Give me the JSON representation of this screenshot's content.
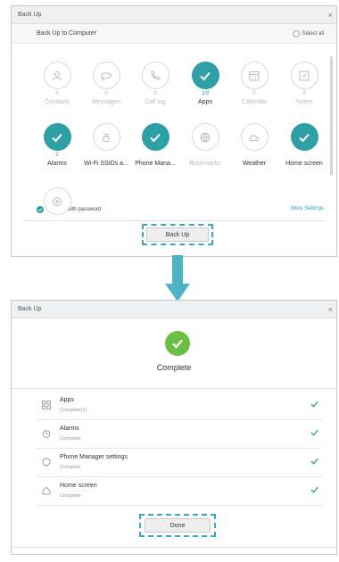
{
  "backup_window": {
    "title": "Back Up",
    "close": "×",
    "subheader": "Back Up to Computer",
    "select_all": "Select all",
    "items": [
      {
        "label": "Contacts",
        "count": "0",
        "selected": false,
        "icon": "contacts-icon"
      },
      {
        "label": "Messages",
        "count": "0",
        "selected": false,
        "icon": "messages-icon"
      },
      {
        "label": "Call log",
        "count": "0",
        "selected": false,
        "icon": "call-log-icon"
      },
      {
        "label": "Apps",
        "count": "1/9",
        "selected": true,
        "icon": "check-icon"
      },
      {
        "label": "Calendar",
        "count": "0",
        "selected": false,
        "icon": "calendar-icon"
      },
      {
        "label": "Notes",
        "count": "0",
        "selected": false,
        "icon": "notes-icon"
      },
      {
        "label": "Alarms",
        "count": "2",
        "selected": true,
        "icon": "check-icon"
      },
      {
        "label": "Wi-Fi SSIDs a...",
        "count": "",
        "selected": false,
        "icon": "wifi-lock-icon"
      },
      {
        "label": "Phone Mana...",
        "count": "",
        "selected": true,
        "icon": "check-icon"
      },
      {
        "label": "Bookmarks",
        "count": "",
        "selected": false,
        "icon": "globe-icon"
      },
      {
        "label": "Weather",
        "count": "",
        "selected": false,
        "icon": "cloud-icon"
      },
      {
        "label": "Home screen",
        "count": "",
        "selected": true,
        "icon": "check-icon"
      },
      {
        "label": "",
        "count": "",
        "selected": false,
        "icon": "extra-icon"
      }
    ],
    "encrypt_label": "Encrypt with password",
    "more_settings": "More Settings",
    "back_up_button": "Back Up"
  },
  "complete_window": {
    "title": "Back Up",
    "close": "×",
    "status": "Complete",
    "rows": [
      {
        "title": "Apps",
        "status": "Complete(1)",
        "icon": "apps-grid-icon"
      },
      {
        "title": "Alarms",
        "status": "Complete",
        "icon": "alarm-clock-icon"
      },
      {
        "title": "Phone Manager settings",
        "status": "Complete",
        "icon": "shield-icon"
      },
      {
        "title": "Home screen",
        "status": "Complete",
        "icon": "home-icon"
      }
    ],
    "done_button": "Done"
  },
  "colors": {
    "accent": "#2f9fa6",
    "highlight": "#3aa9b6",
    "success": "#6abf45"
  }
}
